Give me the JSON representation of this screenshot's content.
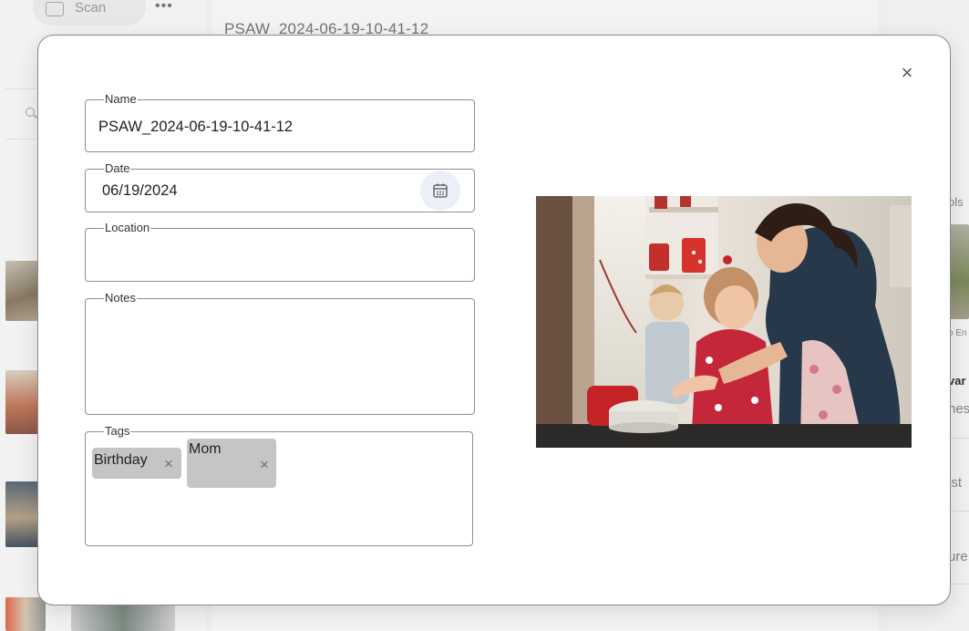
{
  "background": {
    "scan_label": "Scan",
    "more_label": "•••",
    "file_title": "PSAW_2024-06-19-10-41-12",
    "right_fragments": [
      "ols",
      "o En",
      "var",
      "nes",
      "ist",
      "ure"
    ]
  },
  "dialog": {
    "close_label": "×",
    "name": {
      "label": "Name",
      "value": "PSAW_2024-06-19-10-41-12"
    },
    "date": {
      "label": "Date",
      "value": "06/19/2024"
    },
    "location": {
      "label": "Location",
      "value": ""
    },
    "notes": {
      "label": "Notes",
      "value": ""
    },
    "tags": {
      "label": "Tags",
      "items": [
        {
          "label": "Birthday",
          "remove": "×"
        },
        {
          "label": "Mom",
          "remove": "×"
        }
      ]
    }
  },
  "icons": {
    "close": "close-icon",
    "calendar": "calendar-icon",
    "chip_remove": "close-icon"
  }
}
